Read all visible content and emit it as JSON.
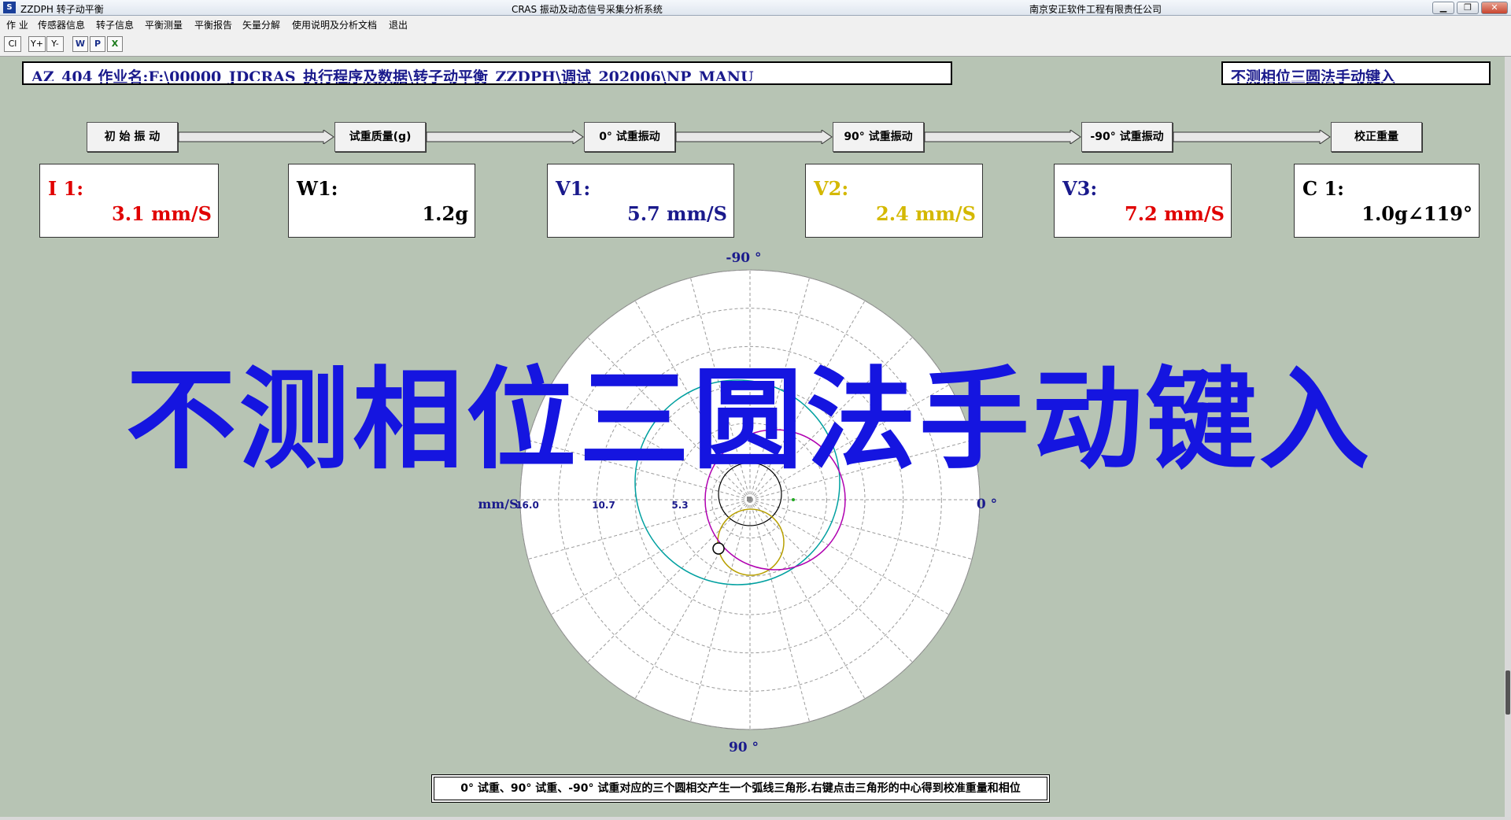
{
  "titlebar": {
    "app_title": "ZZDPH 转子动平衡",
    "center_title": "CRAS 振动及动态信号采集分析系统",
    "company": "南京安正软件工程有限责任公司",
    "app_icon": "S"
  },
  "menu": [
    "作 业",
    "传感器信息",
    "转子信息",
    "平衡测量",
    "平衡报告",
    "矢量分解",
    "使用说明及分析文档",
    "退出"
  ],
  "toolbar": {
    "cl": "Cl",
    "y_plus": "Y+",
    "y_minus": "Y-",
    "w": "W",
    "p": "P",
    "x": "X"
  },
  "header": {
    "job": "AZ_404 作业名:F:\\00000_JDCRAS_执行程序及数据\\转子动平衡_ZZDPH\\调试_202006\\NP_MANU",
    "mode": "不测相位三圆法手动键入"
  },
  "steps": [
    "初 始 振 动",
    "试重质量(g)",
    "0° 试重振动",
    "90° 试重振动",
    "-90° 试重振动",
    "校正重量"
  ],
  "values": [
    {
      "label": "I 1:",
      "value": "3.1 mm/S",
      "label_color": "#e00000",
      "value_color": "#e00000"
    },
    {
      "label": "W1:",
      "value": "1.2g",
      "label_color": "#000000",
      "value_color": "#000000"
    },
    {
      "label": "V1:",
      "value": "5.7 mm/S",
      "label_color": "#1a1a8c",
      "value_color": "#1a1a8c"
    },
    {
      "label": "V2:",
      "value": "2.4 mm/S",
      "label_color": "#d4b800",
      "value_color": "#d4b800"
    },
    {
      "label": "V3:",
      "value": "7.2 mm/S",
      "label_color": "#1a1a8c",
      "value_color": "#e00000"
    },
    {
      "label": "C 1:",
      "value": "1.0g∠119°",
      "label_color": "#000000",
      "value_color": "#000000"
    }
  ],
  "polar": {
    "top_label": "-90 °",
    "bottom_label": "90 °",
    "right_label": "0 °",
    "unit_label": "mm/S",
    "rings": [
      "16.0",
      "10.7",
      "5.3"
    ],
    "circle_colors": {
      "v1": "#00a0a0",
      "v2": "#b8a000",
      "v3": "#b000b0",
      "i1": "#000000"
    }
  },
  "watermark": "不测相位三圆法手动键入",
  "note": "0° 试重、90° 试重、-90° 试重对应的三个圆相交产生一个弧线三角形.右键点击三角形的中心得到校准重量和相位"
}
